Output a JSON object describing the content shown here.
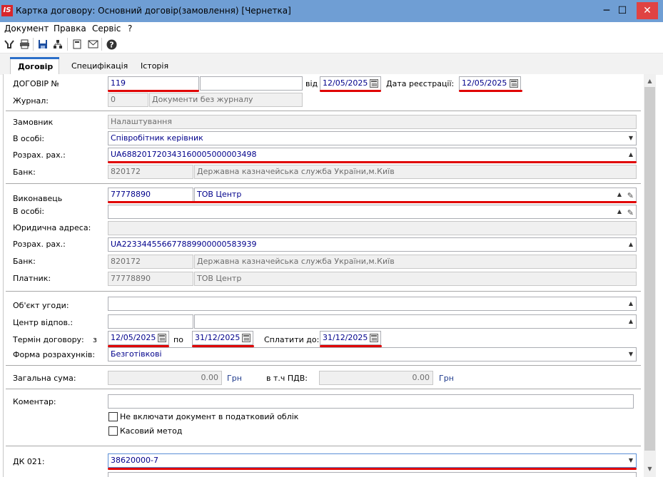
{
  "window": {
    "app_icon": "IS",
    "title": "Картка договору: Основний договір(замовлення) [Чернетка]",
    "minimize": "─",
    "maximize": "☐",
    "close": "✕"
  },
  "menu": [
    "Документ",
    "Правка",
    "Сервіс",
    "?"
  ],
  "toolbar_icons": [
    "filter-icon",
    "print-icon",
    "save-icon",
    "hierarchy-icon",
    "document-icon",
    "mail-icon",
    "help-icon"
  ],
  "tabs": [
    "Договір",
    "Специфікація",
    "Історія"
  ],
  "header": {
    "contract_no_label": "ДОГОВІР №",
    "contract_no": "119",
    "contract_no_extra": "",
    "from_label": "від",
    "from_date": "12/05/2025",
    "reg_date_label": "Дата реєстрації:",
    "reg_date": "12/05/2025",
    "journal_label": "Журнал:",
    "journal_code": "0",
    "journal_name": "Документи без журналу"
  },
  "customer": {
    "customer_label": "Замовник",
    "customer_value": "Налаштування",
    "person_label": "В особі:",
    "person_value": "Співробітник керівник",
    "account_label": "Розрах. рах.:",
    "account_value": "UA688201720343160005000003498",
    "bank_label": "Банк:",
    "bank_code": "820172",
    "bank_name": "Державна казначейська служба України,м.Київ"
  },
  "contractor": {
    "contractor_label": "Виконавець",
    "contractor_code": "77778890",
    "contractor_name": "ТОВ Центр",
    "person_label": "В особі:",
    "person_value": "",
    "legal_address_label": "Юридична адреса:",
    "legal_address": "",
    "account_label": "Розрах. рах.:",
    "account_value": "UA223344556677889900000583939",
    "bank_label": "Банк:",
    "bank_code": "820172",
    "bank_name": "Державна казначейська служба України,м.Київ",
    "payer_label": "Платник:",
    "payer_code": "77778890",
    "payer_name": "ТОВ Центр"
  },
  "terms": {
    "object_label": "Об'єкт угоди:",
    "object_value": "",
    "center_label": "Центр відпов.:",
    "center_code": "",
    "center_name": "",
    "term_label": "Термін договору:",
    "from_prefix": "з",
    "term_from": "12/05/2025",
    "to_prefix": "по",
    "term_to": "31/12/2025",
    "pay_until_label": "Сплатити до:",
    "pay_until": "31/12/2025",
    "payment_form_label": "Форма розрахунків:",
    "payment_form": "Безготівкові"
  },
  "totals": {
    "total_label": "Загальна сума:",
    "total_value": "0.00",
    "total_unit": "Грн",
    "vat_label": "в т.ч ПДВ:",
    "vat_value": "0.00",
    "vat_unit": "Грн"
  },
  "comment": {
    "comment_label": "Коментар:",
    "comment_value": "",
    "exclude_tax_label": "Не включати документ в податковий облік",
    "exclude_tax_checked": false,
    "cash_method_label": "Касовий метод",
    "cash_method_checked": false
  },
  "dk": {
    "dk_label": "ДК 021:",
    "dk_value": "38620000-7"
  }
}
